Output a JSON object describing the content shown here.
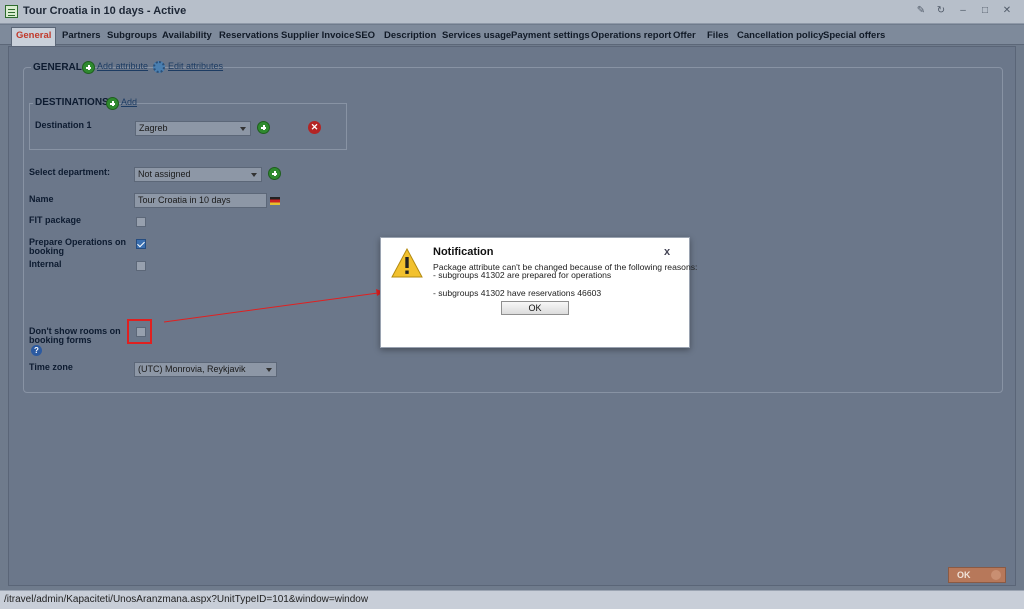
{
  "window": {
    "title": "Tour Croatia in 10 days - Active",
    "controls": [
      "pin-icon",
      "refresh-icon",
      "minimize-icon",
      "maximize-icon",
      "close-icon"
    ]
  },
  "tabs": [
    {
      "label": "General",
      "active": true
    },
    {
      "label": "Partners"
    },
    {
      "label": "Subgroups"
    },
    {
      "label": "Availability"
    },
    {
      "label": "Reservations"
    },
    {
      "label": "Supplier Invoice"
    },
    {
      "label": "SEO"
    },
    {
      "label": "Description"
    },
    {
      "label": "Services usage"
    },
    {
      "label": "Payment settings"
    },
    {
      "label": "Operations report"
    },
    {
      "label": "Offer"
    },
    {
      "label": "Files"
    },
    {
      "label": "Cancellation policy"
    },
    {
      "label": "Special offers"
    }
  ],
  "general": {
    "title": "GENERAL",
    "add_attribute": "Add attribute",
    "edit_attributes": "Edit attributes"
  },
  "destinations": {
    "title": "DESTINATIONS",
    "add": "Add",
    "destination_label": "Destination 1",
    "destination_value": "Zagreb"
  },
  "form": {
    "department_label": "Select department:",
    "department_value": "Not assigned",
    "name_label": "Name",
    "name_value": "Tour Croatia in 10 days",
    "fit_label": "FIT package",
    "fit_checked": false,
    "prepare_label_1": "Prepare Operations on",
    "prepare_label_2": "booking",
    "prepare_checked": true,
    "internal_label": "Internal",
    "internal_checked": false,
    "dont_show_label_1": "Don't show rooms on",
    "dont_show_label_2": "booking forms",
    "dont_show_checked": false,
    "help_glyph": "?",
    "timezone_label": "Time zone",
    "timezone_value": "(UTC) Monrovia, Reykjavik"
  },
  "footer": {
    "ok_label": "OK",
    "status_url": "/itravel/admin/Kapaciteti/UnosAranzmana.aspx?UnitTypeID=101&window=window"
  },
  "dialog": {
    "title": "Notification",
    "close": "x",
    "line1": "Package attribute can't be changed because of the following reasons:",
    "line2": "- subgroups 41302 are prepared for operations",
    "line3": "- subgroups 41302 have reservations 46603",
    "ok_label": "OK"
  },
  "colors": {
    "overlay": "#6f7b8c",
    "highlight": "#e02020",
    "active_tab_text": "#c0392b"
  }
}
